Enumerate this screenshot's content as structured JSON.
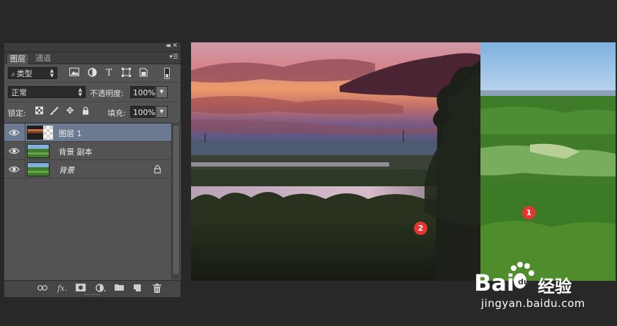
{
  "panel": {
    "tabs": [
      {
        "label": "图层"
      },
      {
        "label": "通道"
      }
    ],
    "filter": {
      "value": "类型",
      "search_icon": "search-icon"
    },
    "filter_icons": [
      "image-filter-icon",
      "adjustment-filter-icon",
      "type-filter-icon",
      "shape-filter-icon",
      "smart-object-filter-icon",
      "filter-toggle-icon"
    ],
    "blend_mode": "正常",
    "opacity": {
      "label": "不透明度:",
      "value": "100%"
    },
    "lock": {
      "label": "锁定:",
      "icons": [
        "lock-transparent-icon",
        "lock-paint-icon",
        "lock-move-icon",
        "lock-all-icon"
      ]
    },
    "fill": {
      "label": "填充:",
      "value": "100%"
    },
    "layers": [
      {
        "name": "图层 1",
        "selected": true,
        "visible": true
      },
      {
        "name": "背景 副本",
        "selected": false,
        "visible": true
      },
      {
        "name": "背景",
        "selected": false,
        "visible": true,
        "locked": true
      }
    ],
    "footer_icons": [
      "link-icon",
      "fx-icon",
      "add-mask-icon",
      "adjustment-layer-icon",
      "new-group-icon",
      "new-layer-icon",
      "delete-icon"
    ],
    "footer_fx": "fx"
  },
  "canvas": {
    "badges": [
      {
        "label": "1"
      },
      {
        "label": "2"
      }
    ]
  },
  "watermark": {
    "brand": "Bai",
    "brand2": "经验",
    "url": "jingyan.baidu.com"
  },
  "colors": {
    "selected_layer": "#6b7a91",
    "badge": "#e63434",
    "panel": "#535353",
    "background": "#282828"
  }
}
